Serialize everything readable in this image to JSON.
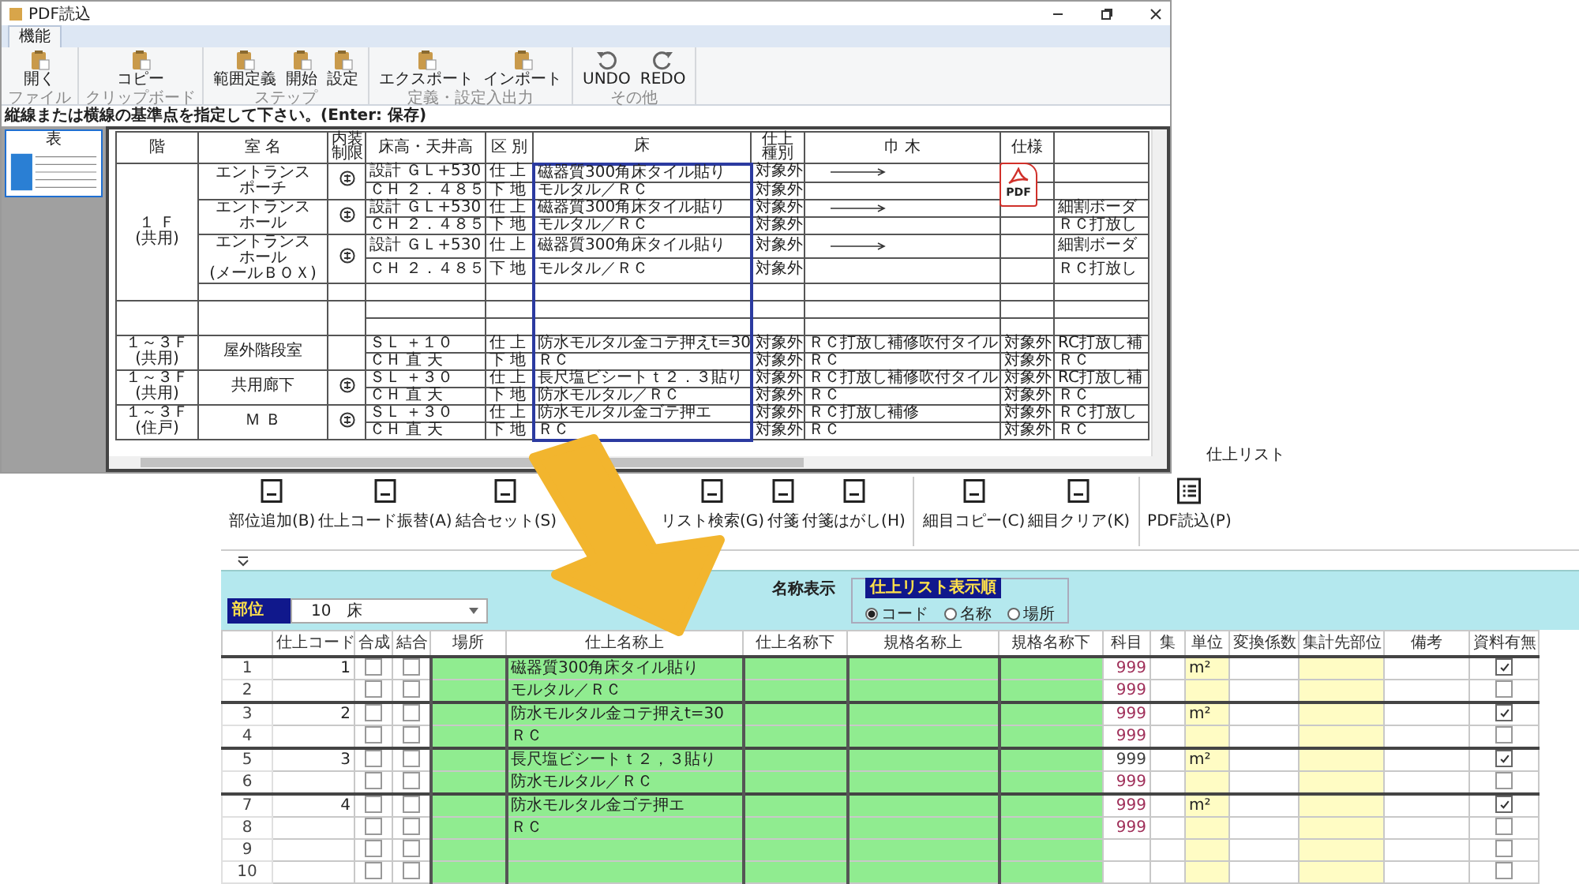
{
  "pdf_window": {
    "title": "PDF読込",
    "tabs": [
      {
        "label": "機能",
        "selected": true
      }
    ],
    "ribbon_groups": [
      {
        "label": "ファイル",
        "buttons": [
          {
            "label": "開く",
            "kind": "clipboard"
          }
        ]
      },
      {
        "label": "クリップボード",
        "buttons": [
          {
            "label": "コピー",
            "kind": "clipboard"
          }
        ]
      },
      {
        "label": "ステップ",
        "buttons": [
          {
            "label": "範囲定義",
            "kind": "clipboard"
          },
          {
            "label": "開始",
            "kind": "clipboard"
          },
          {
            "label": "設定",
            "kind": "clipboard"
          }
        ]
      },
      {
        "label": "定義・設定入出力",
        "buttons": [
          {
            "label": "エクスポート",
            "kind": "clipboard"
          },
          {
            "label": "インポート",
            "kind": "clipboard"
          }
        ]
      },
      {
        "label": "その他",
        "buttons": [
          {
            "label": "UNDO",
            "kind": "undo"
          },
          {
            "label": "REDO",
            "kind": "redo"
          }
        ]
      }
    ],
    "instruction": "縦線または横線の基準点を指定して下さい。(Enter: 保存)",
    "thumbnails": [
      {
        "label": "表",
        "selected": true
      }
    ],
    "pdf_badge": "PDF",
    "pdf_table": {
      "headers": [
        "階",
        "室 名",
        "内装制限",
        "床高・天井高",
        "区 別",
        "床",
        "仕上種別",
        "巾 木",
        "仕様"
      ],
      "groups": [
        {
          "floor": [
            "１ Ｆ",
            "(共用)"
          ],
          "rooms": [
            {
              "name": [
                "エントランス",
                "ポーチ"
              ],
              "mark": true,
              "lines": [
                {
                  "level_height": "設計 ＧＬ+530",
                  "division": "仕 上",
                  "floor_finish": "磁器質300角床タイル貼り",
                  "finish_type": "対象外",
                  "baseboard_arrow": true
                },
                {
                  "level_height": "ＣＨ ２．４８５",
                  "division": "下 地",
                  "floor_finish": "モルタル／ＲＣ",
                  "finish_type": "対象外",
                  "baseboard_arrow": false
                }
              ]
            },
            {
              "name": [
                "エントランス",
                "ホール"
              ],
              "mark": true,
              "lines": [
                {
                  "level_height": "設計 ＧＬ+530",
                  "division": "仕 上",
                  "floor_finish": "磁器質300角床タイル貼り",
                  "finish_type": "対象外",
                  "baseboard_arrow": true,
                  "column_10": "細割ボーダ"
                },
                {
                  "level_height": "ＣＨ ２．４８５",
                  "division": "下 地",
                  "floor_finish": "モルタル／ＲＣ",
                  "finish_type": "対象外",
                  "baseboard_arrow": false,
                  "column_10": "ＲＣ打放し"
                }
              ]
            },
            {
              "name": [
                "エントランス",
                "ホール",
                "(メールＢＯＸ)"
              ],
              "mark": true,
              "lines": [
                {
                  "level_height": "設計 ＧＬ+530",
                  "division": "仕 上",
                  "floor_finish": "磁器質300角床タイル貼り",
                  "finish_type": "対象外",
                  "baseboard_arrow": true,
                  "column_10": "細割ボーダ"
                },
                {
                  "level_height": "ＣＨ ２．４８５",
                  "division": "下 地",
                  "floor_finish": "モルタル／ＲＣ",
                  "finish_type": "対象外",
                  "baseboard_arrow": false,
                  "column_10": "ＲＣ打放し"
                }
              ]
            },
            {
              "mark": false,
              "lines": [
                {
                  "baseboard_arrow": false
                }
              ]
            }
          ]
        },
        {
          "rooms": [
            {
              "mark": false,
              "lines": [
                {
                  "baseboard_arrow": false
                },
                {
                  "baseboard_arrow": false
                }
              ]
            }
          ]
        },
        {
          "floor": [
            "１～３Ｆ",
            "(共用)"
          ],
          "rooms": [
            {
              "name": [
                "屋外階段室"
              ],
              "mark": false,
              "lines": [
                {
                  "level_height": "ＳＬ ＋１０",
                  "division": "仕 上",
                  "floor_finish": "防水モルタル金コテ押えt=30",
                  "finish_type": "対象外",
                  "baseboard": "ＲＣ打放し補修吹付タイル",
                  "baseboard_arrow": false,
                  "spec": "対象外",
                  "column_10": "RC打放し補"
                },
                {
                  "level_height": "ＣＨ 直 天",
                  "division": "下 地",
                  "floor_finish": "ＲＣ",
                  "finish_type": "対象外",
                  "baseboard": "ＲＣ",
                  "baseboard_arrow": false,
                  "spec": "対象外",
                  "column_10": "ＲＣ"
                }
              ]
            }
          ]
        },
        {
          "floor": [
            "１～３Ｆ",
            "(共用)"
          ],
          "rooms": [
            {
              "name": [
                "共用廊下"
              ],
              "mark": true,
              "lines": [
                {
                  "level_height": "ＳＬ ＋３０",
                  "division": "仕 上",
                  "floor_finish": "長尺塩ビシートｔ２．３貼り",
                  "finish_type": "対象外",
                  "baseboard": "ＲＣ打放し補修吹付タイル",
                  "baseboard_arrow": false,
                  "spec": "対象外",
                  "column_10": "RC打放し補"
                },
                {
                  "level_height": "ＣＨ 直 天",
                  "division": "下 地",
                  "floor_finish": "防水モルタル／ＲＣ",
                  "finish_type": "対象外",
                  "baseboard": "ＲＣ",
                  "baseboard_arrow": false,
                  "spec": "対象外",
                  "column_10": "ＲＣ"
                }
              ]
            }
          ]
        },
        {
          "floor": [
            "１～３Ｆ",
            "(住戸)"
          ],
          "rooms": [
            {
              "name": [
                "Ｍ Ｂ"
              ],
              "mark": true,
              "lines": [
                {
                  "level_height": "ＳＬ ＋３０",
                  "division": "仕 上",
                  "floor_finish": "防水モルタル金ゴテ押エ",
                  "finish_type": "対象外",
                  "baseboard": "ＲＣ打放し補修",
                  "baseboard_arrow": false,
                  "spec": "対象外",
                  "column_10": "ＲＣ打放し"
                },
                {
                  "level_height": "ＣＨ 直 天",
                  "division": "下 地",
                  "floor_finish": "ＲＣ",
                  "finish_type": "対象外",
                  "baseboard": "ＲＣ",
                  "baseboard_arrow": false,
                  "spec": "対象外",
                  "column_10": "ＲＣ"
                }
              ]
            }
          ]
        }
      ]
    }
  },
  "list_window": {
    "title": "仕上リスト",
    "toolbar": [
      {
        "label": "部位追加(B)"
      },
      {
        "label": "仕上コード振替(A)"
      },
      {
        "label": "結合セット(S)"
      },
      {
        "label": "リスト検索(G)"
      },
      {
        "label": "付箋"
      },
      {
        "label": "付箋はがし(H)"
      },
      {
        "label": "細目コピー(C)"
      },
      {
        "label": "細目クリア(K)"
      },
      {
        "label": "PDF読込(P)"
      }
    ],
    "part_label": "部位",
    "part_value": "10　床",
    "name_display": "名称表示",
    "order_group": {
      "title": "仕上リスト表示順",
      "options": [
        {
          "label": "コード",
          "selected": true
        },
        {
          "label": "名称",
          "selected": false
        },
        {
          "label": "場所",
          "selected": false
        }
      ]
    },
    "grid": {
      "columns": [
        "仕上コード",
        "合成",
        "結合",
        "場所",
        "仕上名称上",
        "仕上名称下",
        "規格名称上",
        "規格名称下",
        "科目",
        "集",
        "単位",
        "変換係数",
        "集計先部位",
        "備考",
        "資料有無"
      ],
      "rows": [
        {
          "no": "1",
          "code": "1",
          "group_start": true,
          "composite": false,
          "joined": false,
          "name_upper": "磁器質300角床タイル貼り",
          "subject": "999",
          "color": "#a0305a",
          "unit": "m²",
          "materials": true
        },
        {
          "no": "2",
          "group_start": false,
          "composite": false,
          "joined": false,
          "name_upper": "モルタル／ＲＣ",
          "subject": "999",
          "color": "#a0305a",
          "materials": false
        },
        {
          "no": "3",
          "code": "2",
          "group_start": true,
          "composite": false,
          "joined": false,
          "name_upper": "防水モルタル金コテ押えt=30",
          "subject": "999",
          "color": "#a0305a",
          "unit": "m²",
          "materials": true
        },
        {
          "no": "4",
          "group_start": false,
          "composite": false,
          "joined": false,
          "name_upper": "ＲＣ",
          "subject": "999",
          "color": "#a0305a",
          "materials": false
        },
        {
          "no": "5",
          "code": "3",
          "group_start": true,
          "composite": false,
          "joined": false,
          "name_upper": "長尺塩ビシートｔ２，３貼り",
          "subject": "999",
          "color": "#404040",
          "unit": "m²",
          "materials": true
        },
        {
          "no": "6",
          "group_start": false,
          "composite": false,
          "joined": false,
          "name_upper": "防水モルタル／ＲＣ",
          "subject": "999",
          "color": "#a0305a",
          "materials": false
        },
        {
          "no": "7",
          "code": "4",
          "group_start": true,
          "composite": false,
          "joined": false,
          "name_upper": "防水モルタル金ゴテ押エ",
          "subject": "999",
          "color": "#a0305a",
          "unit": "m²",
          "materials": true
        },
        {
          "no": "8",
          "group_start": false,
          "composite": false,
          "joined": false,
          "name_upper": "ＲＣ",
          "subject": "999",
          "color": "#a0305a",
          "materials": false
        },
        {
          "no": "9",
          "group_start": false,
          "composite": false,
          "joined": false,
          "materials": false
        },
        {
          "no": "10",
          "group_start": false,
          "composite": false,
          "joined": false,
          "materials": false
        }
      ]
    }
  }
}
